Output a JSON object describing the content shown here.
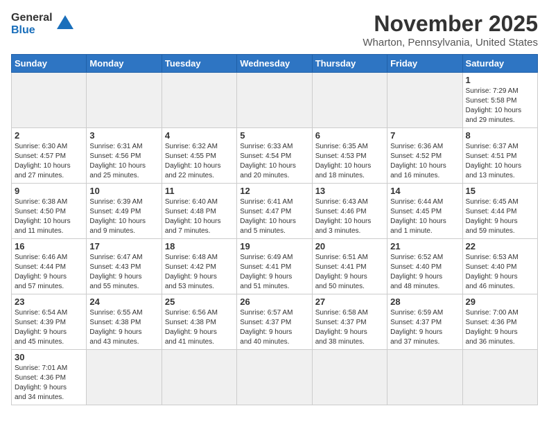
{
  "header": {
    "logo_general": "General",
    "logo_blue": "Blue",
    "title": "November 2025",
    "subtitle": "Wharton, Pennsylvania, United States"
  },
  "days_of_week": [
    "Sunday",
    "Monday",
    "Tuesday",
    "Wednesday",
    "Thursday",
    "Friday",
    "Saturday"
  ],
  "weeks": [
    [
      {
        "day": null,
        "empty": true
      },
      {
        "day": null,
        "empty": true
      },
      {
        "day": null,
        "empty": true
      },
      {
        "day": null,
        "empty": true
      },
      {
        "day": null,
        "empty": true
      },
      {
        "day": null,
        "empty": true
      },
      {
        "day": 1,
        "info": "Sunrise: 7:29 AM\nSunset: 5:58 PM\nDaylight: 10 hours\nand 29 minutes."
      }
    ],
    [
      {
        "day": 2,
        "info": "Sunrise: 6:30 AM\nSunset: 4:57 PM\nDaylight: 10 hours\nand 27 minutes."
      },
      {
        "day": 3,
        "info": "Sunrise: 6:31 AM\nSunset: 4:56 PM\nDaylight: 10 hours\nand 25 minutes."
      },
      {
        "day": 4,
        "info": "Sunrise: 6:32 AM\nSunset: 4:55 PM\nDaylight: 10 hours\nand 22 minutes."
      },
      {
        "day": 5,
        "info": "Sunrise: 6:33 AM\nSunset: 4:54 PM\nDaylight: 10 hours\nand 20 minutes."
      },
      {
        "day": 6,
        "info": "Sunrise: 6:35 AM\nSunset: 4:53 PM\nDaylight: 10 hours\nand 18 minutes."
      },
      {
        "day": 7,
        "info": "Sunrise: 6:36 AM\nSunset: 4:52 PM\nDaylight: 10 hours\nand 16 minutes."
      },
      {
        "day": 8,
        "info": "Sunrise: 6:37 AM\nSunset: 4:51 PM\nDaylight: 10 hours\nand 13 minutes."
      }
    ],
    [
      {
        "day": 9,
        "info": "Sunrise: 6:38 AM\nSunset: 4:50 PM\nDaylight: 10 hours\nand 11 minutes."
      },
      {
        "day": 10,
        "info": "Sunrise: 6:39 AM\nSunset: 4:49 PM\nDaylight: 10 hours\nand 9 minutes."
      },
      {
        "day": 11,
        "info": "Sunrise: 6:40 AM\nSunset: 4:48 PM\nDaylight: 10 hours\nand 7 minutes."
      },
      {
        "day": 12,
        "info": "Sunrise: 6:41 AM\nSunset: 4:47 PM\nDaylight: 10 hours\nand 5 minutes."
      },
      {
        "day": 13,
        "info": "Sunrise: 6:43 AM\nSunset: 4:46 PM\nDaylight: 10 hours\nand 3 minutes."
      },
      {
        "day": 14,
        "info": "Sunrise: 6:44 AM\nSunset: 4:45 PM\nDaylight: 10 hours\nand 1 minute."
      },
      {
        "day": 15,
        "info": "Sunrise: 6:45 AM\nSunset: 4:44 PM\nDaylight: 9 hours\nand 59 minutes."
      }
    ],
    [
      {
        "day": 16,
        "info": "Sunrise: 6:46 AM\nSunset: 4:44 PM\nDaylight: 9 hours\nand 57 minutes."
      },
      {
        "day": 17,
        "info": "Sunrise: 6:47 AM\nSunset: 4:43 PM\nDaylight: 9 hours\nand 55 minutes."
      },
      {
        "day": 18,
        "info": "Sunrise: 6:48 AM\nSunset: 4:42 PM\nDaylight: 9 hours\nand 53 minutes."
      },
      {
        "day": 19,
        "info": "Sunrise: 6:49 AM\nSunset: 4:41 PM\nDaylight: 9 hours\nand 51 minutes."
      },
      {
        "day": 20,
        "info": "Sunrise: 6:51 AM\nSunset: 4:41 PM\nDaylight: 9 hours\nand 50 minutes."
      },
      {
        "day": 21,
        "info": "Sunrise: 6:52 AM\nSunset: 4:40 PM\nDaylight: 9 hours\nand 48 minutes."
      },
      {
        "day": 22,
        "info": "Sunrise: 6:53 AM\nSunset: 4:40 PM\nDaylight: 9 hours\nand 46 minutes."
      }
    ],
    [
      {
        "day": 23,
        "info": "Sunrise: 6:54 AM\nSunset: 4:39 PM\nDaylight: 9 hours\nand 45 minutes."
      },
      {
        "day": 24,
        "info": "Sunrise: 6:55 AM\nSunset: 4:38 PM\nDaylight: 9 hours\nand 43 minutes."
      },
      {
        "day": 25,
        "info": "Sunrise: 6:56 AM\nSunset: 4:38 PM\nDaylight: 9 hours\nand 41 minutes."
      },
      {
        "day": 26,
        "info": "Sunrise: 6:57 AM\nSunset: 4:37 PM\nDaylight: 9 hours\nand 40 minutes."
      },
      {
        "day": 27,
        "info": "Sunrise: 6:58 AM\nSunset: 4:37 PM\nDaylight: 9 hours\nand 38 minutes."
      },
      {
        "day": 28,
        "info": "Sunrise: 6:59 AM\nSunset: 4:37 PM\nDaylight: 9 hours\nand 37 minutes."
      },
      {
        "day": 29,
        "info": "Sunrise: 7:00 AM\nSunset: 4:36 PM\nDaylight: 9 hours\nand 36 minutes."
      }
    ],
    [
      {
        "day": 30,
        "info": "Sunrise: 7:01 AM\nSunset: 4:36 PM\nDaylight: 9 hours\nand 34 minutes."
      },
      {
        "day": null,
        "empty": true
      },
      {
        "day": null,
        "empty": true
      },
      {
        "day": null,
        "empty": true
      },
      {
        "day": null,
        "empty": true
      },
      {
        "day": null,
        "empty": true
      },
      {
        "day": null,
        "empty": true
      }
    ]
  ]
}
